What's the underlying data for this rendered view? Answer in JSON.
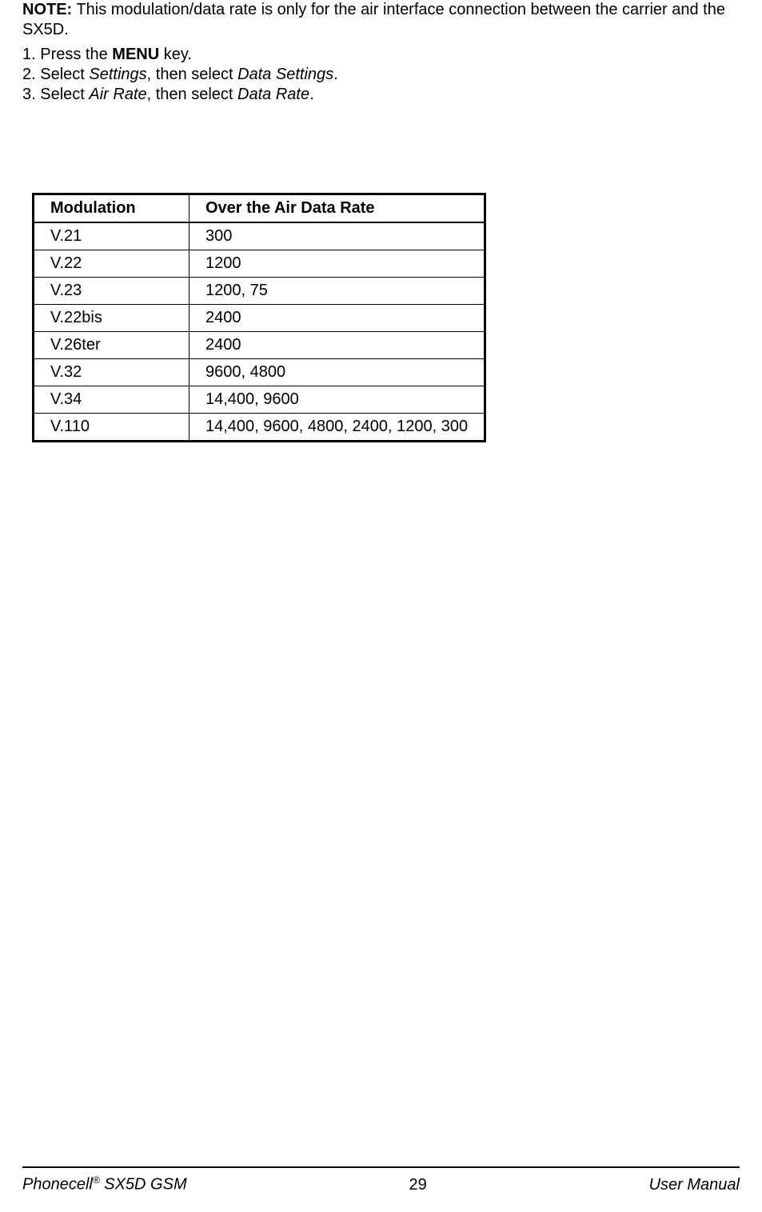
{
  "note": {
    "label": "NOTE:",
    "text_before": " This modulation/data rate is only for the air interface connection between the carrier and the SX5D."
  },
  "steps": [
    {
      "prefix": "1. Press the ",
      "bold": "MENU",
      "suffix": " key."
    },
    {
      "prefix": "2. Select ",
      "italic1": "Settings",
      "mid": ", then select ",
      "italic2": "Data Settings",
      "suffix": "."
    },
    {
      "prefix": "3. Select ",
      "italic1": "Air Rate",
      "mid": ", then select ",
      "italic2": "Data Rate",
      "suffix": "."
    }
  ],
  "table": {
    "headers": [
      "Modulation",
      "Over the Air Data Rate"
    ],
    "rows": [
      [
        "V.21",
        "300"
      ],
      [
        "V.22",
        "1200"
      ],
      [
        "V.23",
        "1200, 75"
      ],
      [
        "V.22bis",
        "2400"
      ],
      [
        "V.26ter",
        "2400"
      ],
      [
        "V.32",
        "9600, 4800"
      ],
      [
        "V.34",
        "14,400, 9600"
      ],
      [
        "V.110",
        "14,400, 9600, 4800, 2400, 1200, 300"
      ]
    ]
  },
  "footer": {
    "left_brand": "Phonecell",
    "left_reg": "®",
    "left_model": " SX5D GSM",
    "page": "29",
    "right": "User Manual"
  }
}
